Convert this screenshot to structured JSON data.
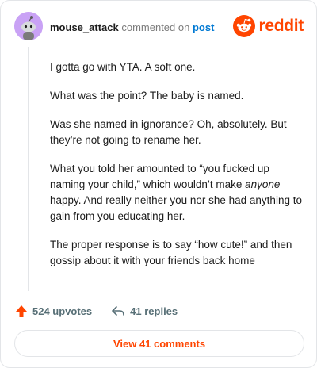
{
  "header": {
    "username": "mouse_attack",
    "action_text": "commented on",
    "post_link": "post",
    "brand": "reddit"
  },
  "comment": {
    "paragraphs": [
      "I gotta go with YTA. A soft one.",
      "What was the point? The baby is named.",
      "Was she named in ignorance? Oh, absolutely. But they’re not going to rename her.",
      {
        "before": "What you told her amounted to “you fucked up naming your child,” which wouldn’t make ",
        "emphasis": "anyone",
        "after": " happy. And really neither you nor she had anything to gain from you educating her."
      },
      "The proper response is to say “how cute!” and then gossip about it with your friends back home"
    ]
  },
  "actions": {
    "upvotes": "524 upvotes",
    "replies": "41 replies"
  },
  "footer": {
    "view_comments": "View 41 comments"
  },
  "colors": {
    "brand": "#ff4500",
    "link": "#0079d3",
    "avatar_bg": "#c9a2f5"
  },
  "icons": [
    "snoo-avatar-icon",
    "reddit-logo-icon",
    "upvote-arrow-icon",
    "reply-arrow-icon"
  ]
}
